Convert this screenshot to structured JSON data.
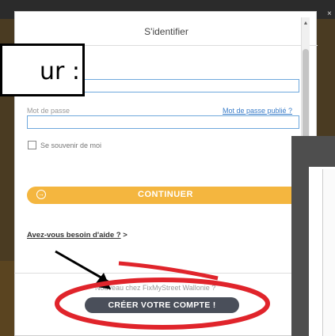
{
  "dialog": {
    "title": "S'identifier",
    "password_label": "Mot de passe",
    "forgot_link": "Mot de passe publié ?",
    "remember_label": "Se souvenir de moi",
    "continue_label": "CONTINUER",
    "continue_icon": "arrow-circle-icon",
    "help_link": "Avez-vous besoin d'aide ?",
    "help_arrow": ">",
    "new_text": "Nouveau chez FixMyStreet Wallonie ?",
    "create_label": "CRÉER VOTRE COMPTE !"
  },
  "callout": {
    "text": "ur :"
  },
  "window": {
    "close_glyph": "×"
  },
  "colors": {
    "accent": "#f4b63f",
    "create_button": "#4a4f5a",
    "annotation_red": "#e0242b",
    "link": "#3a7dc9"
  }
}
